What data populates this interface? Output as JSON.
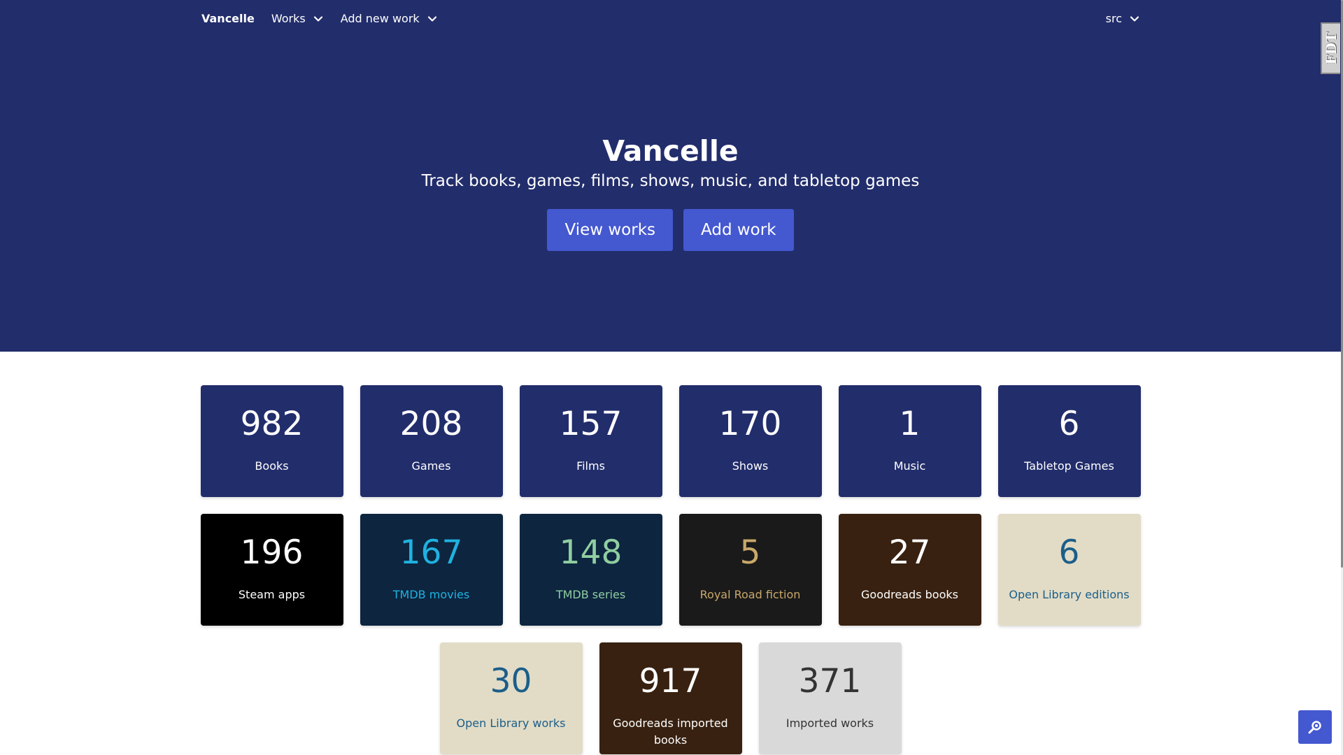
{
  "navbar": {
    "brand": "Vancelle",
    "works_label": "Works",
    "add_new_work_label": "Add new work",
    "src_label": "src"
  },
  "hero": {
    "title": "Vancelle",
    "subtitle": "Track books, games, films, shows, music, and tabletop games",
    "view_works_label": "View works",
    "add_work_label": "Add work"
  },
  "debug_tab": {
    "label": "FDT"
  },
  "stats": {
    "row1": [
      {
        "value": "982",
        "label": "Books",
        "bg": "#222d6b",
        "fg": "#ffffff",
        "label_fg": "#ffffff"
      },
      {
        "value": "208",
        "label": "Games",
        "bg": "#222d6b",
        "fg": "#ffffff",
        "label_fg": "#ffffff"
      },
      {
        "value": "157",
        "label": "Films",
        "bg": "#222d6b",
        "fg": "#ffffff",
        "label_fg": "#ffffff"
      },
      {
        "value": "170",
        "label": "Shows",
        "bg": "#222d6b",
        "fg": "#ffffff",
        "label_fg": "#ffffff"
      },
      {
        "value": "1",
        "label": "Music",
        "bg": "#222d6b",
        "fg": "#ffffff",
        "label_fg": "#ffffff"
      },
      {
        "value": "6",
        "label": "Tabletop Games",
        "bg": "#222d6b",
        "fg": "#ffffff",
        "label_fg": "#ffffff"
      }
    ],
    "row2": [
      {
        "value": "196",
        "label": "Steam apps",
        "bg": "#000000",
        "fg": "#ffffff",
        "label_fg": "#ffffff"
      },
      {
        "value": "167",
        "label": "TMDB movies",
        "bg": "#0d253f",
        "fg": "#1fb2e0",
        "label_fg": "#1fb2e0"
      },
      {
        "value": "148",
        "label": "TMDB series",
        "bg": "#0d253f",
        "fg": "#90cea1",
        "label_fg": "#90cea1"
      },
      {
        "value": "5",
        "label": "Royal Road fiction",
        "bg": "#1a1a1a",
        "fg": "#c9a86a",
        "label_fg": "#c9a86a"
      },
      {
        "value": "27",
        "label": "Goodreads books",
        "bg": "#382110",
        "fg": "#ffffff",
        "label_fg": "#ffffff"
      },
      {
        "value": "6",
        "label": "Open Library editions",
        "bg": "#e2dcc6",
        "fg": "#1b5e8a",
        "label_fg": "#1b5e8a"
      }
    ],
    "row3": [
      {
        "value": "30",
        "label": "Open Library works",
        "bg": "#e2dcc6",
        "fg": "#1b5e8a",
        "label_fg": "#1b5e8a"
      },
      {
        "value": "917",
        "label": "Goodreads imported books",
        "bg": "#382110",
        "fg": "#ffffff",
        "label_fg": "#ffffff"
      },
      {
        "value": "371",
        "label": "Imported works",
        "bg": "#d9d9d9",
        "fg": "#333333",
        "label_fg": "#333333"
      }
    ]
  },
  "icons": {
    "chevron": "chevron-down-icon",
    "fab": "search-icon"
  },
  "colors": {
    "hero_bg": "#222d6b",
    "button_bg": "#4458d0"
  }
}
